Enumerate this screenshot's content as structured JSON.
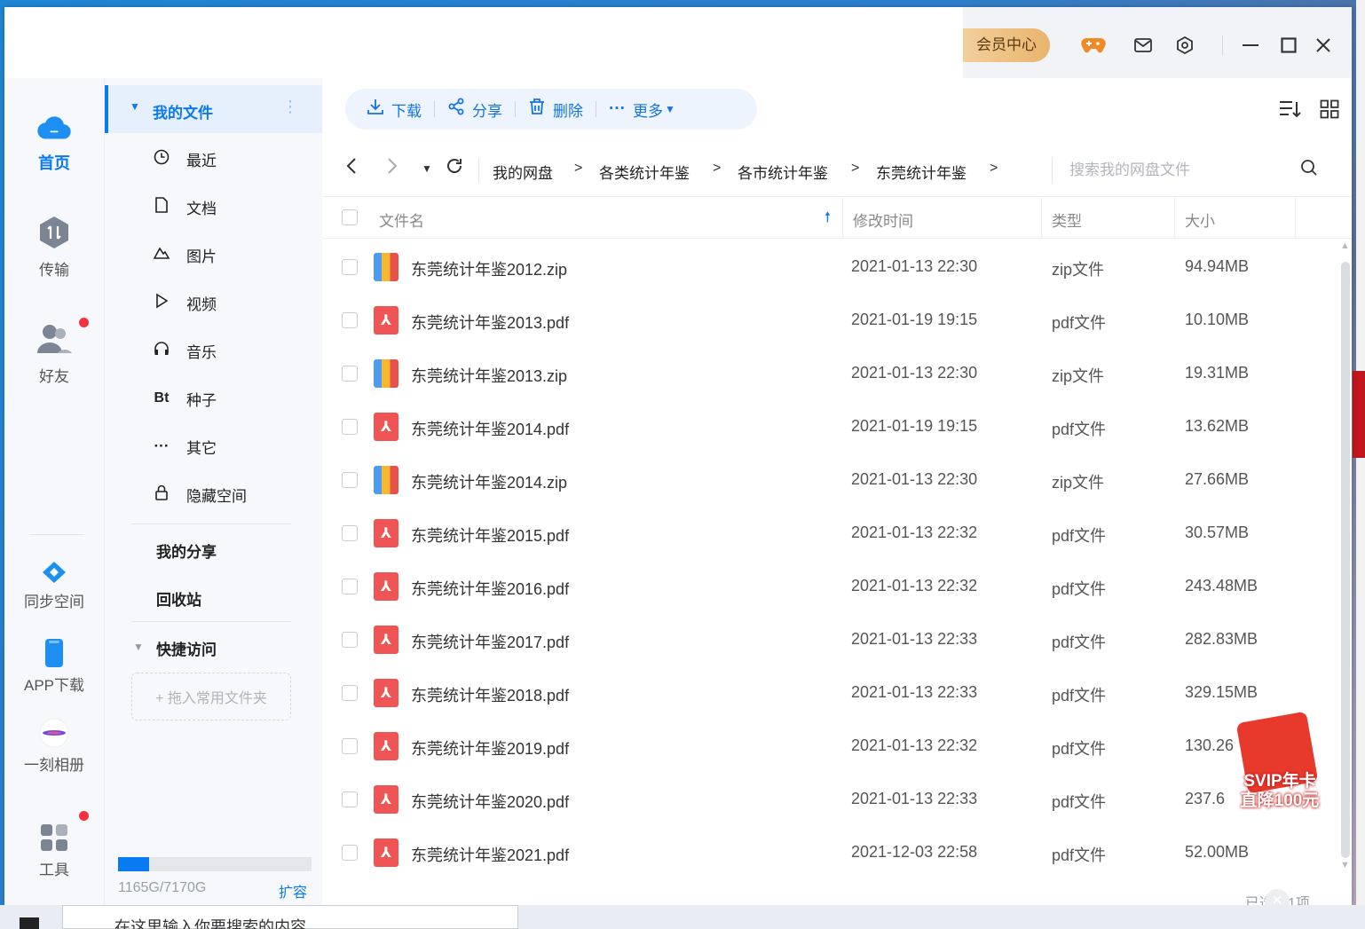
{
  "window": {
    "vip_center": "会员中心"
  },
  "rail": {
    "home": "首页",
    "transfer": "传输",
    "friends": "好友",
    "sync_space": "同步空间",
    "app_download": "APP下载",
    "moment_album": "一刻相册",
    "tools": "工具"
  },
  "sidebar": {
    "my_files": "我的文件",
    "items": [
      {
        "label": "最近",
        "icon": "clock-icon"
      },
      {
        "label": "文档",
        "icon": "document-icon"
      },
      {
        "label": "图片",
        "icon": "image-icon"
      },
      {
        "label": "视频",
        "icon": "video-icon"
      },
      {
        "label": "音乐",
        "icon": "headphone-icon"
      },
      {
        "label": "种子",
        "icon": "bt-icon"
      },
      {
        "label": "其它",
        "icon": "more-icon"
      },
      {
        "label": "隐藏空间",
        "icon": "lock-icon"
      }
    ],
    "my_share": "我的分享",
    "recycle": "回收站",
    "quick_access": "快捷访问",
    "drop_hint": "+ 拖入常用文件夹",
    "quota": "1165G/7170G",
    "quota_fraction": 0.1625,
    "expand": "扩容"
  },
  "toolbar": {
    "download": "下载",
    "share": "分享",
    "delete": "删除",
    "more": "更多"
  },
  "path": {
    "crumbs": [
      "我的网盘",
      "各类统计年鉴",
      "各市统计年鉴",
      "东莞统计年鉴"
    ],
    "search_placeholder": "搜索我的网盘文件"
  },
  "table": {
    "headers": {
      "name": "文件名",
      "modified": "修改时间",
      "type": "类型",
      "size": "大小"
    },
    "rows": [
      {
        "name": "东莞统计年鉴2012.zip",
        "date": "2021-01-13 22:30",
        "type": "zip文件",
        "size": "94.94MB",
        "kind": "zip"
      },
      {
        "name": "东莞统计年鉴2013.pdf",
        "date": "2021-01-19 19:15",
        "type": "pdf文件",
        "size": "10.10MB",
        "kind": "pdf"
      },
      {
        "name": "东莞统计年鉴2013.zip",
        "date": "2021-01-13 22:30",
        "type": "zip文件",
        "size": "19.31MB",
        "kind": "zip"
      },
      {
        "name": "东莞统计年鉴2014.pdf",
        "date": "2021-01-19 19:15",
        "type": "pdf文件",
        "size": "13.62MB",
        "kind": "pdf"
      },
      {
        "name": "东莞统计年鉴2014.zip",
        "date": "2021-01-13 22:30",
        "type": "zip文件",
        "size": "27.66MB",
        "kind": "zip"
      },
      {
        "name": "东莞统计年鉴2015.pdf",
        "date": "2021-01-13 22:32",
        "type": "pdf文件",
        "size": "30.57MB",
        "kind": "pdf"
      },
      {
        "name": "东莞统计年鉴2016.pdf",
        "date": "2021-01-13 22:32",
        "type": "pdf文件",
        "size": "243.48MB",
        "kind": "pdf"
      },
      {
        "name": "东莞统计年鉴2017.pdf",
        "date": "2021-01-13 22:33",
        "type": "pdf文件",
        "size": "282.83MB",
        "kind": "pdf"
      },
      {
        "name": "东莞统计年鉴2018.pdf",
        "date": "2021-01-13 22:33",
        "type": "pdf文件",
        "size": "329.15MB",
        "kind": "pdf"
      },
      {
        "name": "东莞统计年鉴2019.pdf",
        "date": "2021-01-13 22:32",
        "type": "pdf文件",
        "size": "130.26",
        "kind": "pdf"
      },
      {
        "name": "东莞统计年鉴2020.pdf",
        "date": "2021-01-13 22:33",
        "type": "pdf文件",
        "size": "237.6",
        "kind": "pdf"
      },
      {
        "name": "东莞统计年鉴2021.pdf",
        "date": "2021-12-03 22:58",
        "type": "pdf文件",
        "size": "52.00MB",
        "kind": "pdf"
      }
    ]
  },
  "status": {
    "selected": "已选中1项"
  },
  "promo": {
    "line1": "SVIP年卡",
    "line2": "直降100元"
  },
  "taskbar": {
    "search_text": "在这里输入你要搜索的内容"
  },
  "colors": {
    "accent": "#0a7af0",
    "pdf": "#f05555",
    "badge": "#f5313d"
  }
}
